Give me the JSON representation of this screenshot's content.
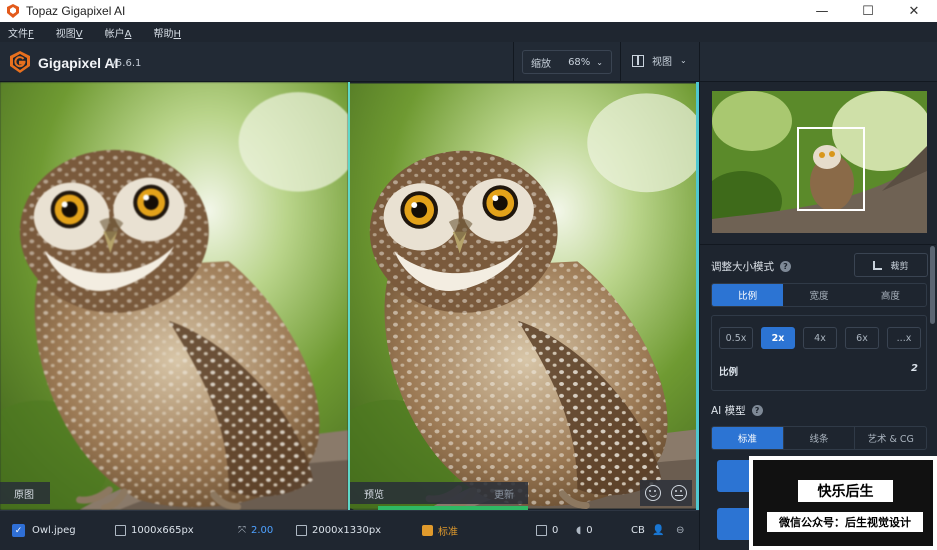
{
  "window": {
    "title": "Topaz Gigapixel AI",
    "minimize": "—",
    "maximize": "☐",
    "close": "✕"
  },
  "menu": [
    {
      "label": "文件",
      "key": "F"
    },
    {
      "label": "视图",
      "key": "V"
    },
    {
      "label": "帐户",
      "key": "A"
    },
    {
      "label": "帮助",
      "key": "H"
    }
  ],
  "header": {
    "brand": "Gigapixel AI",
    "version": "v5.6.1",
    "zoom_label": "缩放",
    "zoom_value": "68%",
    "view_label": "视图"
  },
  "panes": {
    "original_label": "原图",
    "preview_label": "预览",
    "update_label": "更新"
  },
  "status": {
    "filename": "Owl.jpeg",
    "input_size": "1000x665px",
    "scale": "2.00",
    "output_size": "2000x1330px",
    "model": "标准",
    "noise": "0",
    "blur": "0",
    "compression": "CB"
  },
  "sidebar": {
    "resize_title": "调整大小模式",
    "crop_label": "裁剪",
    "mode_tabs": [
      "比例",
      "宽度",
      "高度"
    ],
    "scale_options": [
      "0.5x",
      "2x",
      "4x",
      "6x",
      "...x"
    ],
    "ratio_label": "比例",
    "ratio_value": "2",
    "ai_title": "AI 模型",
    "ai_tabs": [
      "标准",
      "线条",
      "艺术 & CG"
    ]
  },
  "watermark": {
    "line1": "快乐后生",
    "line2": "微信公众号：后生视觉设计"
  },
  "colors": {
    "accent": "#2c74d3",
    "divider": "#5fd8c8",
    "status_blue": "#4ea1ff",
    "status_orange": "#e09a2c"
  }
}
